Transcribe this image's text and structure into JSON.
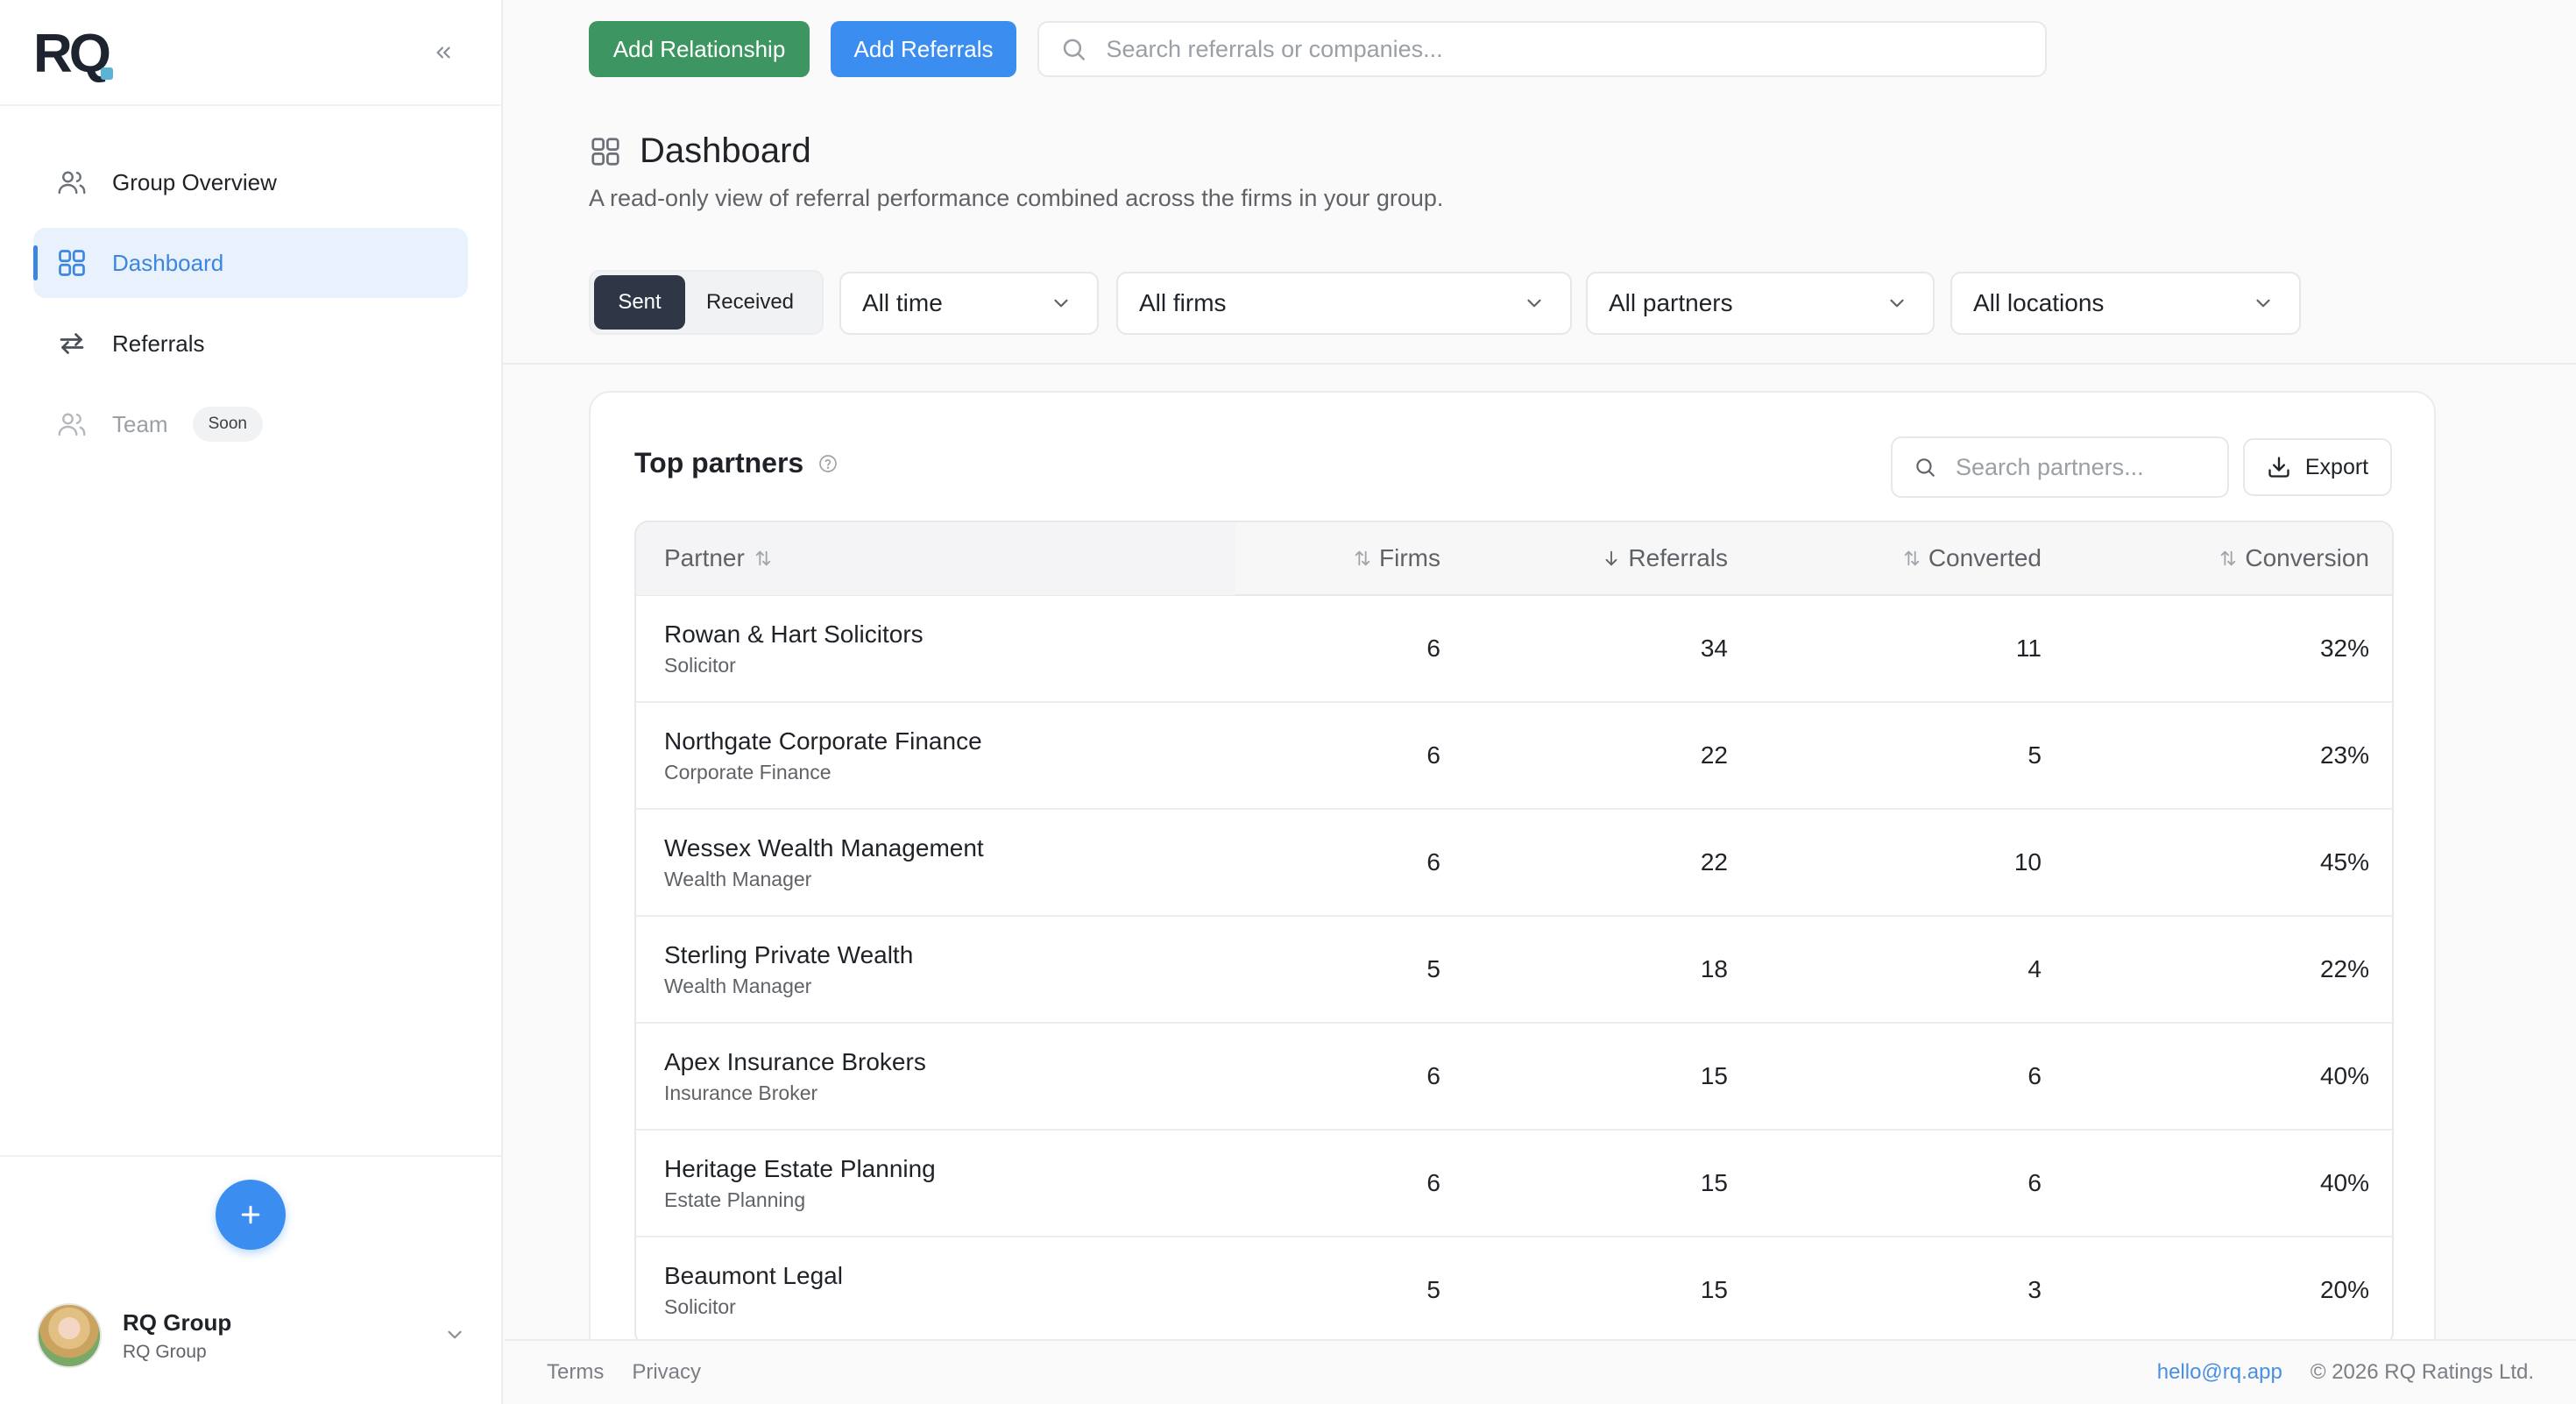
{
  "app": {
    "logo_text": "RQ"
  },
  "sidebar": {
    "items": [
      {
        "label": "Group Overview",
        "icon": "users-icon",
        "active": false
      },
      {
        "label": "Dashboard",
        "icon": "grid-icon",
        "active": true
      },
      {
        "label": "Referrals",
        "icon": "arrows-swap-icon",
        "active": false
      },
      {
        "label": "Team",
        "icon": "users-icon",
        "active": false,
        "badge": "Soon",
        "disabled": true
      }
    ],
    "add_button_icon": "plus-icon",
    "user": {
      "name": "RQ Group",
      "org": "RQ Group"
    }
  },
  "topbar": {
    "add_relationship": "Add Relationship",
    "add_referrals": "Add Referrals",
    "search_placeholder": "Search referrals or companies..."
  },
  "header": {
    "title": "Dashboard",
    "description": "A read-only view of referral performance combined across the firms in your group."
  },
  "filters": {
    "toggle": {
      "sent": "Sent",
      "received": "Received",
      "selected": "Sent"
    },
    "time": "All time",
    "firms": "All firms",
    "partners": "All partners",
    "locations": "All locations"
  },
  "top_partners": {
    "title": "Top partners",
    "search_placeholder": "Search partners...",
    "export_label": "Export",
    "columns": {
      "partner": "Partner",
      "firms": "Firms",
      "referrals": "Referrals",
      "converted": "Converted",
      "conversion": "Conversion"
    },
    "rows": [
      {
        "name": "Rowan & Hart Solicitors",
        "type": "Solicitor",
        "firms": "6",
        "referrals": "34",
        "converted": "11",
        "conversion": "32%"
      },
      {
        "name": "Northgate Corporate Finance",
        "type": "Corporate Finance",
        "firms": "6",
        "referrals": "22",
        "converted": "5",
        "conversion": "23%"
      },
      {
        "name": "Wessex Wealth Management",
        "type": "Wealth Manager",
        "firms": "6",
        "referrals": "22",
        "converted": "10",
        "conversion": "45%"
      },
      {
        "name": "Sterling Private Wealth",
        "type": "Wealth Manager",
        "firms": "5",
        "referrals": "18",
        "converted": "4",
        "conversion": "22%"
      },
      {
        "name": "Apex Insurance Brokers",
        "type": "Insurance Broker",
        "firms": "6",
        "referrals": "15",
        "converted": "6",
        "conversion": "40%"
      },
      {
        "name": "Heritage Estate Planning",
        "type": "Estate Planning",
        "firms": "6",
        "referrals": "15",
        "converted": "6",
        "conversion": "40%"
      },
      {
        "name": "Beaumont Legal",
        "type": "Solicitor",
        "firms": "5",
        "referrals": "15",
        "converted": "3",
        "conversion": "20%"
      }
    ]
  },
  "footer": {
    "terms": "Terms",
    "privacy": "Privacy",
    "email": "hello@rq.app",
    "copyright": "© 2026 RQ Ratings Ltd."
  },
  "colors": {
    "accent": "#3b8ef0",
    "green": "#3d9661",
    "dark": "#2f3747"
  }
}
